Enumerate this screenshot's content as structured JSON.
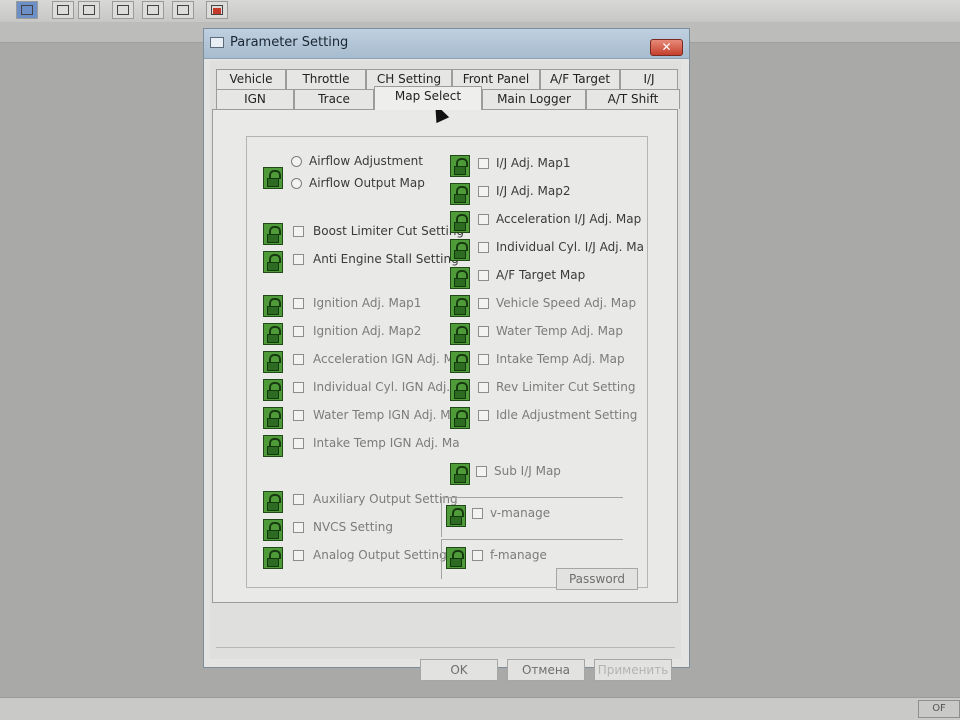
{
  "dialog": {
    "title": "Parameter Setting",
    "close_label": "✕"
  },
  "tabs_row1": [
    "Vehicle",
    "Throttle",
    "CH Setting",
    "Front Panel",
    "A/F Target",
    "I/J"
  ],
  "tabs_row2": [
    "IGN",
    "Trace",
    "Map Select",
    "Main Logger",
    "A/T Shift"
  ],
  "active_tab": "Map Select",
  "left_items": [
    "Airflow Adjustment",
    "Airflow Output Map",
    "Boost Limiter Cut Setting",
    "Anti Engine Stall Setting",
    "Ignition Adj. Map1",
    "Ignition Adj. Map2",
    "Acceleration IGN Adj. Ma",
    "Individual Cyl. IGN Adj. M",
    "Water Temp IGN Adj. Ma",
    "Intake Temp IGN Adj. Ma",
    "Auxiliary Output Setting",
    "NVCS Setting",
    "Analog Output Setting"
  ],
  "right_items": [
    "I/J Adj. Map1",
    "I/J Adj. Map2",
    "Acceleration I/J Adj. Map",
    "Individual Cyl. I/J Adj. Ma",
    "A/F Target Map",
    "Vehicle Speed Adj. Map",
    "Water Temp Adj. Map",
    "Intake Temp Adj. Map",
    "Rev Limiter Cut Setting",
    "Idle Adjustment Setting",
    "Sub I/J Map",
    "v-manage",
    "f-manage"
  ],
  "buttons": {
    "password": "Password",
    "ok": "OK",
    "cancel": "Отмена",
    "apply": "Применить"
  },
  "statusbar": {
    "corner": "OF"
  }
}
